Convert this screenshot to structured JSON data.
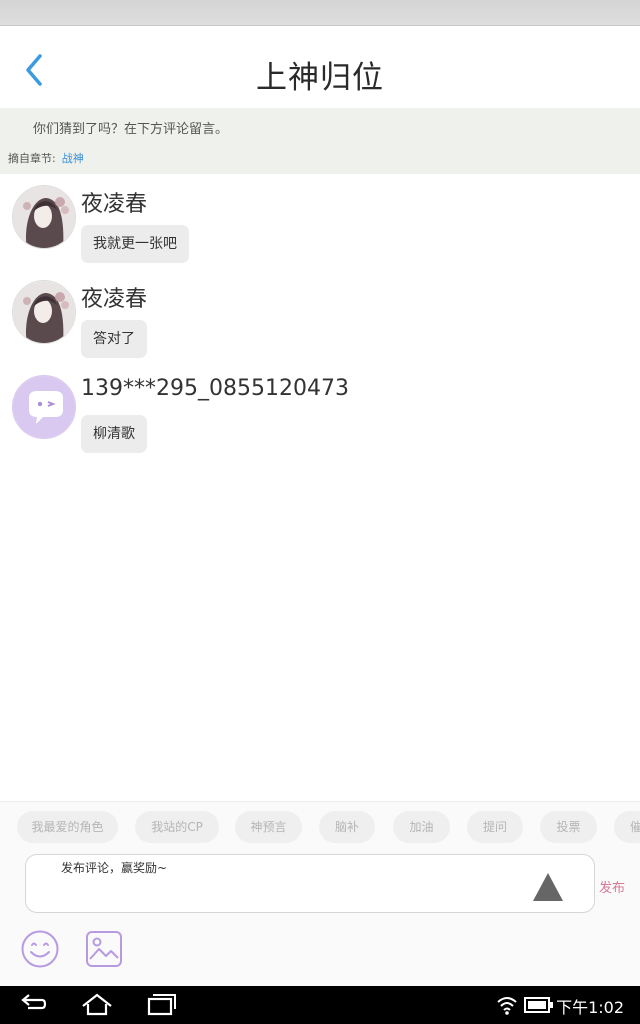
{
  "header": {
    "title": "上神归位"
  },
  "quote": {
    "text": "你们猜到了吗？在下方评论留言。",
    "chapter_label": "摘自章节:",
    "chapter_name": "战神"
  },
  "comments": [
    {
      "user": "夜凌春",
      "text": "我就更一张吧"
    },
    {
      "user": "夜凌春",
      "text": "答对了"
    },
    {
      "user": "139***295_0855120473",
      "text": "柳清歌"
    }
  ],
  "tags": [
    "我最爱的角色",
    "我站的CP",
    "神预言",
    "脑补",
    "加油",
    "提问",
    "投票",
    "催更"
  ],
  "input": {
    "placeholder": "发布评论，赢奖励~",
    "publish_label": "发布"
  },
  "status": {
    "time": "下午1:02"
  },
  "colors": {
    "accent": "#3a8fd4",
    "publish": "#d67a96",
    "avatar_purple": "#d9c8f0"
  }
}
